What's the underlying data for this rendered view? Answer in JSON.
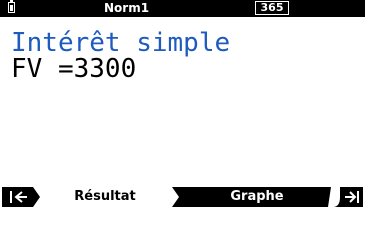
{
  "status_bar": {
    "mode": "Norm1",
    "day_count": "365",
    "battery_icon": "battery-icon"
  },
  "main": {
    "title": "Intérêt simple",
    "result_line": "FV =3300"
  },
  "function_keys": {
    "prev_icon": "back-arrow-icon",
    "result_label": "Résultat",
    "graph_label": "Graphe",
    "next_icon": "forward-arrow-icon"
  },
  "colors": {
    "title": "#1f5bbf",
    "bar": "#000000"
  }
}
